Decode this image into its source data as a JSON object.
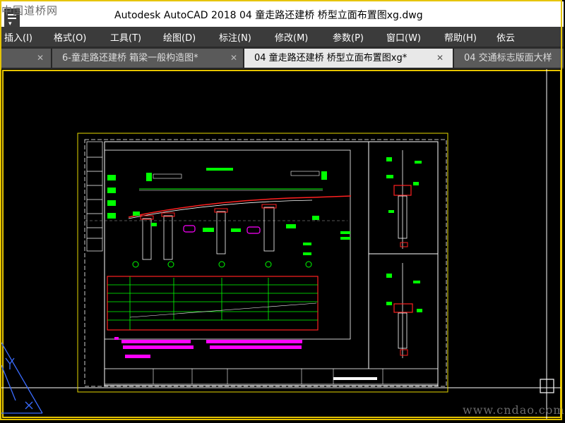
{
  "watermark_top": "中国道桥网",
  "watermark_bottom": "www.cndao.com",
  "window": {
    "title": "Autodesk AutoCAD 2018      04 童走路还建桥 桥型立面布置图xg.dwg"
  },
  "menu": [
    "插入(I)",
    "格式(O)",
    "工具(T)",
    "绘图(D)",
    "标注(N)",
    "修改(M)",
    "参数(P)",
    "窗口(W)",
    "帮助(H)",
    "依云"
  ],
  "tabs": [
    {
      "label": "6-童走路还建桥 箱梁一般构造图*",
      "active": false
    },
    {
      "label": "04 童走路还建桥 桥型立面布置图xg*",
      "active": true
    },
    {
      "label": "04 交通标志版面大样",
      "active": false
    }
  ],
  "colors": {
    "accent": "#e6c400",
    "drawing_green": "#00ff00",
    "drawing_magenta": "#ff00ff",
    "drawing_red": "#ff2020"
  }
}
